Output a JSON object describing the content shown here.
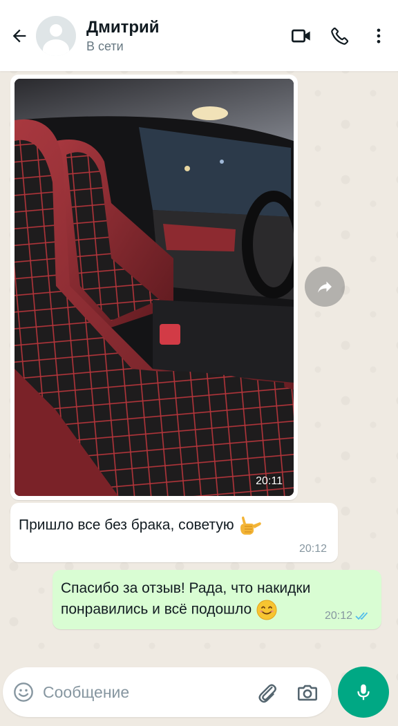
{
  "header": {
    "back_icon": "arrow-left-icon",
    "contact_name": "Дмитрий",
    "status": "В сети",
    "video_icon": "video-call-icon",
    "call_icon": "phone-icon",
    "menu_icon": "more-vertical-icon"
  },
  "messages": [
    {
      "type": "image",
      "direction": "incoming",
      "image_desc_icon": "car-seat-photo",
      "time": "20:11"
    },
    {
      "type": "text",
      "direction": "incoming",
      "text": "Пришло все без брака, советую",
      "emoji_icon": "call-me-hand-emoji",
      "time": "20:12"
    },
    {
      "type": "text",
      "direction": "outgoing",
      "text": "Спасибо за отзыв! Рада, что накидки понравились и всё подошло",
      "emoji_icon": "smiling-face-emoji",
      "time": "20:12",
      "status_icon": "double-check-read-icon"
    }
  ],
  "forward_icon": "forward-arrow-icon",
  "composer": {
    "placeholder": "Сообщение",
    "value": "",
    "emoji_icon": "emoji-icon",
    "attach_icon": "paperclip-icon",
    "camera_icon": "camera-icon",
    "mic_icon": "microphone-icon"
  },
  "colors": {
    "accent": "#00a884",
    "outgoing_bubble": "#d9fdd3",
    "incoming_bubble": "#ffffff",
    "read_check": "#53bdeb",
    "chat_background": "#efeae2"
  }
}
